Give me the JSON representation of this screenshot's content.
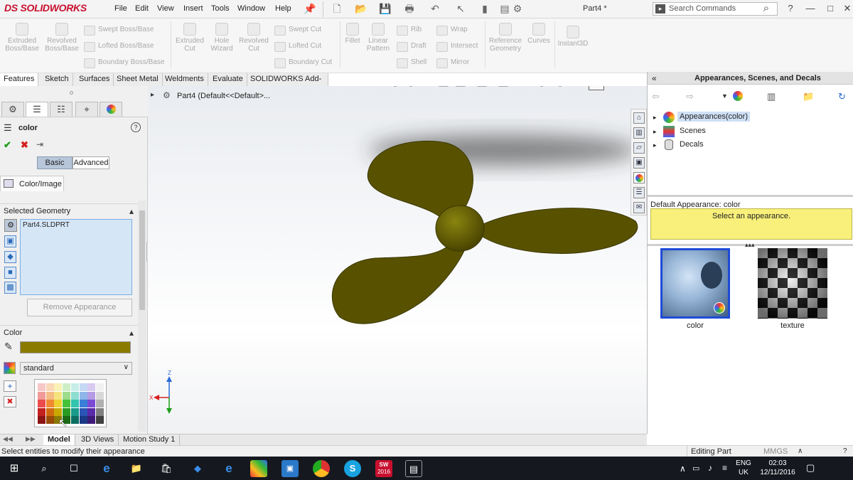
{
  "app": {
    "logo": "SOLIDWORKS",
    "logo_prefix": "DS",
    "doc_title": "Part4 *"
  },
  "menu": [
    "File",
    "Edit",
    "View",
    "Insert",
    "Tools",
    "Window",
    "Help"
  ],
  "search": {
    "placeholder": "Search Commands"
  },
  "ribbon": {
    "extruded_boss": "Extruded Boss/Base",
    "revolved_boss": "Revolved Boss/Base",
    "swept_boss": "Swept Boss/Base",
    "lofted_boss": "Lofted Boss/Base",
    "boundary_boss": "Boundary Boss/Base",
    "extruded_cut": "Extruded Cut",
    "hole_wizard": "Hole Wizard",
    "revolved_cut": "Revolved Cut",
    "swept_cut": "Swept Cut",
    "lofted_cut": "Lofted Cut",
    "boundary_cut": "Boundary Cut",
    "fillet": "Fillet",
    "linear_pattern": "Linear Pattern",
    "rib": "Rib",
    "draft": "Draft",
    "shell": "Shell",
    "wrap": "Wrap",
    "intersect": "Intersect",
    "mirror": "Mirror",
    "reference_geometry": "Reference Geometry",
    "curves": "Curves",
    "instant3d": "Instant3D"
  },
  "command_tabs": [
    "Features",
    "Sketch",
    "Surfaces",
    "Sheet Metal",
    "Weldments",
    "Evaluate",
    "SOLIDWORKS Add-Ins"
  ],
  "feature_tree": {
    "part_label": "Part4  (Default<<Default>..."
  },
  "property_manager": {
    "title": "color",
    "tab_basic": "Basic",
    "tab_advanced": "Advanced",
    "color_image_tab": "Color/Image",
    "selected_geometry_header": "Selected Geometry",
    "selected_item": "Part4.SLDPRT",
    "remove_button": "Remove Appearance",
    "color_header": "Color",
    "current_color": "#8a7a00",
    "palette_select": "standard"
  },
  "palette_colors": [
    "#f6c7c7",
    "#f9d7b7",
    "#f9f1b5",
    "#cdeec4",
    "#c7eee8",
    "#c4d9f3",
    "#d9caf0",
    "#f0f0f0",
    "#f29a9a",
    "#f4bb85",
    "#f4e47f",
    "#9edc8b",
    "#8fddd1",
    "#8fb6e8",
    "#b59be3",
    "#d8d8d8",
    "#eb4b4b",
    "#ef8a33",
    "#eed232",
    "#45c23a",
    "#33c4ae",
    "#3b7fd8",
    "#7b4bd4",
    "#b0b0b0",
    "#c42020",
    "#d06a10",
    "#c9a900",
    "#2a9a22",
    "#1a9a8a",
    "#2a55b5",
    "#5a2aa8",
    "#808080",
    "#8e1414",
    "#9a4a08",
    "#8a7a00",
    "#1a6a16",
    "#0e6e62",
    "#1a3a86",
    "#3e1a78",
    "#404040"
  ],
  "taskpane": {
    "title": "Appearances, Scenes, and Decals",
    "tree": [
      "Appearances(color)",
      "Scenes",
      "Decals"
    ],
    "default_label": "Default Appearance: color",
    "info": "Select an appearance.",
    "thumbs": [
      "color",
      "texture"
    ]
  },
  "bottom_tabs": [
    "Model",
    "3D Views",
    "Motion Study 1"
  ],
  "status": {
    "message": "Select entities to modify their appearance",
    "mode": "Editing Part",
    "units": "MMGS"
  },
  "taskbar": {
    "lang": "ENG",
    "region": "UK",
    "time": "02:03",
    "date": "12/11/2016",
    "sw_badge": "2016"
  }
}
